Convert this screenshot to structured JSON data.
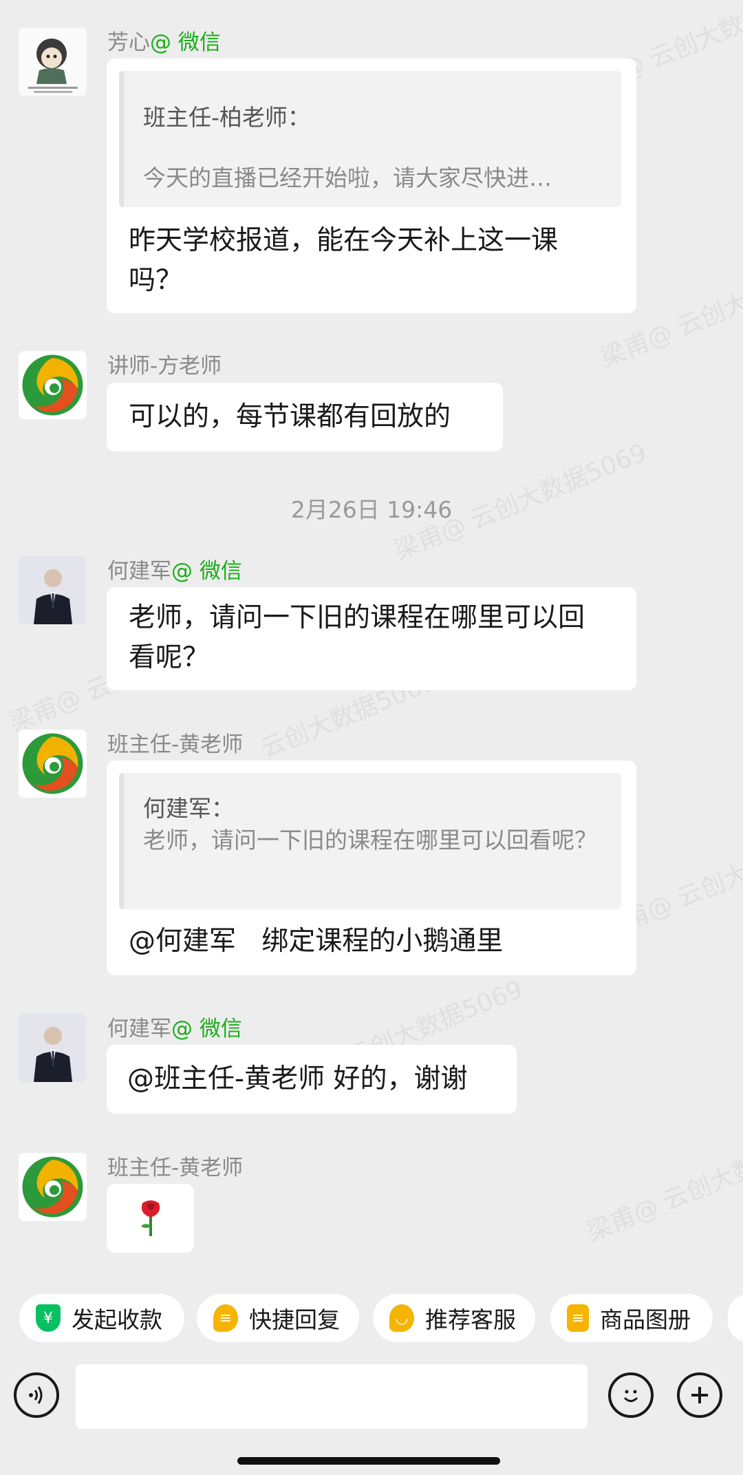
{
  "messages": {
    "m1": {
      "sender_name": "芳心",
      "sender_source": "@ 微信",
      "quote_name": "班主任-柏老师：",
      "quote_text": "今天的直播已经开始啦，请大家尽快进…",
      "text": "昨天学校报道，能在今天补上这一课吗？"
    },
    "m2": {
      "sender_name": "讲师-方老师",
      "text": "可以的，每节课都有回放的"
    },
    "timestamp": "2月26日  19:46",
    "m3": {
      "sender_name": "何建军",
      "sender_source": "@ 微信",
      "text": "老师，请问一下旧的课程在哪里可以回看呢？"
    },
    "m4": {
      "sender_name": "班主任-黄老师",
      "quote_name": "何建军：",
      "quote_text": "老师，请问一下旧的课程在哪里可以回看呢？",
      "text": "@何建军   绑定课程的小鹅通里"
    },
    "m5": {
      "sender_name": "何建军",
      "sender_source": "@ 微信",
      "text": "@班主任-黄老师 好的，谢谢"
    },
    "m6": {
      "sender_name": "班主任-黄老师",
      "emoji": "🌹"
    }
  },
  "watermarks": [
    "梁甫@ 云创大数据5069",
    "云创大数据5069"
  ],
  "quick_actions": [
    {
      "label": "发起收款",
      "icon": "payment-icon",
      "color": "#07c160"
    },
    {
      "label": "快捷回复",
      "icon": "quick-reply-icon",
      "color": "#f5b400"
    },
    {
      "label": "推荐客服",
      "icon": "recommend-service-icon",
      "color": "#f5b400"
    },
    {
      "label": "商品图册",
      "icon": "product-catalog-icon",
      "color": "#f5b400"
    }
  ],
  "input": {
    "placeholder": ""
  }
}
